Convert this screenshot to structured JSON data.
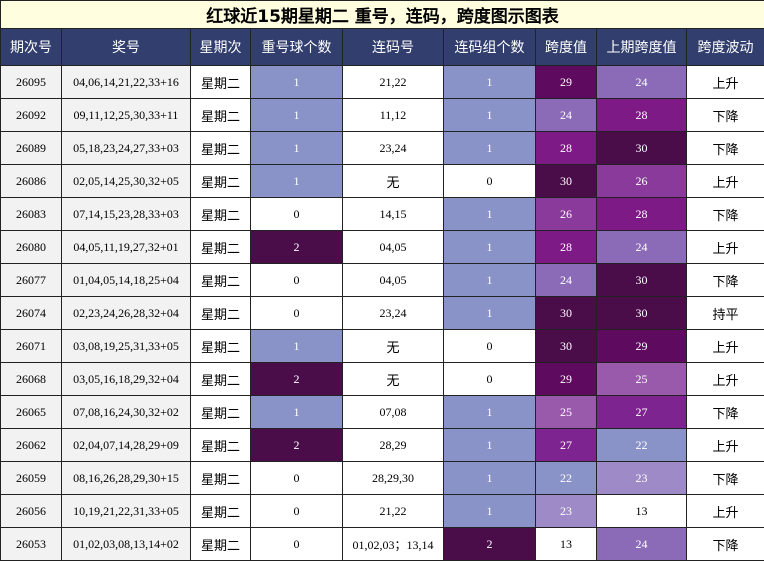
{
  "title": "红球近15期星期二 重号，连码，跨度图示图表",
  "headers": [
    "期次号",
    "奖号",
    "星期次",
    "重号球个数",
    "连码号",
    "连码组个数",
    "跨度值",
    "上期跨度值",
    "跨度波动"
  ],
  "rows": [
    {
      "issue": "26095",
      "numbers": "04,06,14,21,22,33+16",
      "weekday": "星期二",
      "repeat": "1",
      "lianma": "21,22",
      "groups": "1",
      "span": "29",
      "prev_span": "24",
      "trend": "上升"
    },
    {
      "issue": "26092",
      "numbers": "09,11,12,25,30,33+11",
      "weekday": "星期二",
      "repeat": "1",
      "lianma": "11,12",
      "groups": "1",
      "span": "24",
      "prev_span": "28",
      "trend": "下降"
    },
    {
      "issue": "26089",
      "numbers": "05,18,23,24,27,33+03",
      "weekday": "星期二",
      "repeat": "1",
      "lianma": "23,24",
      "groups": "1",
      "span": "28",
      "prev_span": "30",
      "trend": "下降"
    },
    {
      "issue": "26086",
      "numbers": "02,05,14,25,30,32+05",
      "weekday": "星期二",
      "repeat": "1",
      "lianma": "无",
      "groups": "0",
      "span": "30",
      "prev_span": "26",
      "trend": "上升"
    },
    {
      "issue": "26083",
      "numbers": "07,14,15,23,28,33+03",
      "weekday": "星期二",
      "repeat": "0",
      "lianma": "14,15",
      "groups": "1",
      "span": "26",
      "prev_span": "28",
      "trend": "下降"
    },
    {
      "issue": "26080",
      "numbers": "04,05,11,19,27,32+01",
      "weekday": "星期二",
      "repeat": "2",
      "lianma": "04,05",
      "groups": "1",
      "span": "28",
      "prev_span": "24",
      "trend": "上升"
    },
    {
      "issue": "26077",
      "numbers": "01,04,05,14,18,25+04",
      "weekday": "星期二",
      "repeat": "0",
      "lianma": "04,05",
      "groups": "1",
      "span": "24",
      "prev_span": "30",
      "trend": "下降"
    },
    {
      "issue": "26074",
      "numbers": "02,23,24,26,28,32+04",
      "weekday": "星期二",
      "repeat": "0",
      "lianma": "23,24",
      "groups": "1",
      "span": "30",
      "prev_span": "30",
      "trend": "持平"
    },
    {
      "issue": "26071",
      "numbers": "03,08,19,25,31,33+05",
      "weekday": "星期二",
      "repeat": "1",
      "lianma": "无",
      "groups": "0",
      "span": "30",
      "prev_span": "29",
      "trend": "上升"
    },
    {
      "issue": "26068",
      "numbers": "03,05,16,18,29,32+04",
      "weekday": "星期二",
      "repeat": "2",
      "lianma": "无",
      "groups": "0",
      "span": "29",
      "prev_span": "25",
      "trend": "上升"
    },
    {
      "issue": "26065",
      "numbers": "07,08,16,24,30,32+02",
      "weekday": "星期二",
      "repeat": "1",
      "lianma": "07,08",
      "groups": "1",
      "span": "25",
      "prev_span": "27",
      "trend": "下降"
    },
    {
      "issue": "26062",
      "numbers": "02,04,07,14,28,29+09",
      "weekday": "星期二",
      "repeat": "2",
      "lianma": "28,29",
      "groups": "1",
      "span": "27",
      "prev_span": "22",
      "trend": "上升"
    },
    {
      "issue": "26059",
      "numbers": "08,16,26,28,29,30+15",
      "weekday": "星期二",
      "repeat": "0",
      "lianma": "28,29,30",
      "groups": "1",
      "span": "22",
      "prev_span": "23",
      "trend": "下降"
    },
    {
      "issue": "26056",
      "numbers": "10,19,21,22,31,33+05",
      "weekday": "星期二",
      "repeat": "0",
      "lianma": "21,22",
      "groups": "1",
      "span": "23",
      "prev_span": "13",
      "trend": "上升"
    },
    {
      "issue": "26053",
      "numbers": "01,02,03,08,13,14+02",
      "weekday": "星期二",
      "repeat": "0",
      "lianma": "01,02,03；13,14",
      "groups": "2",
      "span": "13",
      "prev_span": "24",
      "trend": "下降"
    }
  ],
  "colors": {
    "title_bg": "#ffffe0",
    "header_bg": "#323f6e",
    "header_text": "#ffffff",
    "repeat_0": "#ffffff",
    "repeat_1": "#8a93c8",
    "repeat_2": "#4a0d4a",
    "groups_0": "#ffffff",
    "groups_1": "#8a93c8",
    "groups_2": "#4a0d4a",
    "span_13": "#ffffff",
    "span_22": "#8a93c8",
    "span_23": "#9d8ac6",
    "span_24": "#8b6ab8",
    "span_25": "#9a5aac",
    "span_26": "#8a3a9a",
    "span_27": "#7e2490",
    "span_28": "#7d1a85",
    "span_29": "#5e0a5e",
    "span_30": "#4a0d4a"
  }
}
